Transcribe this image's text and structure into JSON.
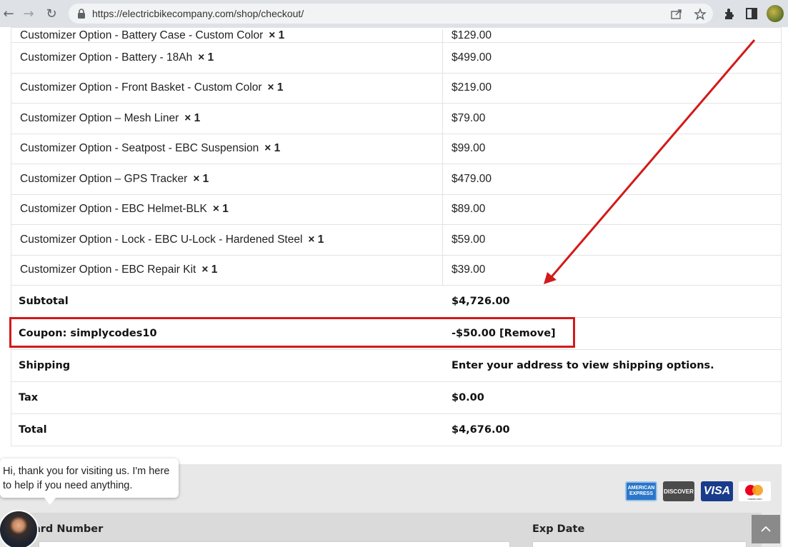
{
  "browser": {
    "url": "https://electricbikecompany.com/shop/checkout/",
    "back_icon": "←",
    "forward_icon": "→",
    "reload_icon": "↻"
  },
  "order_items": [
    {
      "name": "Customizer Option - Battery Case - Custom Color",
      "qty": "× 1",
      "price": "$129.00"
    },
    {
      "name": "Customizer Option - Battery - 18Ah",
      "qty": "× 1",
      "price": "$499.00"
    },
    {
      "name": "Customizer Option - Front Basket - Custom Color",
      "qty": "× 1",
      "price": "$219.00"
    },
    {
      "name": "Customizer Option – Mesh Liner",
      "qty": "× 1",
      "price": "$79.00"
    },
    {
      "name": "Customizer Option - Seatpost - EBC Suspension",
      "qty": "× 1",
      "price": "$99.00"
    },
    {
      "name": "Customizer Option – GPS Tracker",
      "qty": "× 1",
      "price": "$479.00"
    },
    {
      "name": "Customizer Option - EBC Helmet-BLK",
      "qty": "× 1",
      "price": "$89.00"
    },
    {
      "name": "Customizer Option - Lock - EBC U-Lock - Hardened Steel",
      "qty": "× 1",
      "price": "$59.00"
    },
    {
      "name": "Customizer Option - EBC Repair Kit",
      "qty": "× 1",
      "price": "$39.00"
    }
  ],
  "totals": {
    "subtotal_label": "Subtotal",
    "subtotal_value": "$4,726.00",
    "coupon_label": "Coupon: simplycodes10",
    "coupon_value": "-$50.00",
    "coupon_remove": "[Remove]",
    "shipping_label": "Shipping",
    "shipping_value": "Enter your address to view shipping options.",
    "tax_label": "Tax",
    "tax_value": "$0.00",
    "total_label": "Total",
    "total_value": "$4,676.00"
  },
  "payment": {
    "card_number_label": "ard Number",
    "exp_date_label": "Exp Date",
    "cards": [
      "AMERICAN EXPRESS",
      "DISCOVER",
      "VISA",
      "mastercard"
    ]
  },
  "chat": {
    "message": "Hi, thank you for visiting us. I'm here to help if you need anything."
  },
  "colors": {
    "highlight": "#d21a1a",
    "panel_bg": "#e8e8e8"
  }
}
